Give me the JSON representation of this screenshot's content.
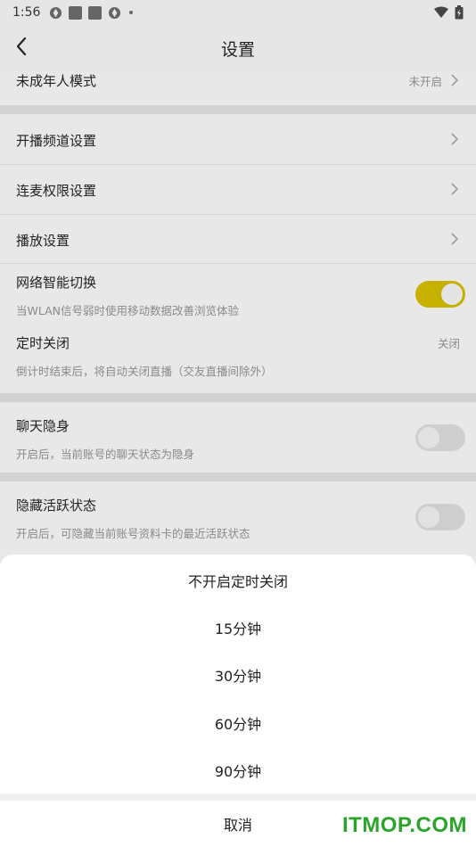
{
  "status_bar": {
    "time": "1:56"
  },
  "header": {
    "title": "设置"
  },
  "section1": {
    "minor_mode": {
      "label": "未成年人模式",
      "value": "未开启"
    }
  },
  "section2": {
    "channel": {
      "label": "开播频道设置"
    },
    "mic_permission": {
      "label": "连麦权限设置"
    },
    "playback": {
      "label": "播放设置"
    },
    "network_switch": {
      "label": "网络智能切换",
      "sub": "当WLAN信号弱时使用移动数据改善浏览体验",
      "enabled": true
    },
    "timer_close": {
      "label": "定时关闭",
      "sub": "倒计时结束后，将自动关闭直播（交友直播间除外）",
      "value": "关闭"
    }
  },
  "section3": {
    "chat_invisible": {
      "label": "聊天隐身",
      "sub": "开启后，当前账号的聊天状态为隐身",
      "enabled": false
    }
  },
  "section4": {
    "hide_active": {
      "label": "隐藏活跃状态",
      "sub": "开启后，可隐藏当前账号资料卡的最近活跃状态",
      "enabled": false
    }
  },
  "sheet": {
    "options": [
      "不开启定时关闭",
      "15分钟",
      "30分钟",
      "60分钟",
      "90分钟"
    ],
    "cancel": "取消"
  },
  "watermark": "ITMOP.COM",
  "colors": {
    "accent": "#c6b000",
    "watermark": "#2aa52a"
  }
}
